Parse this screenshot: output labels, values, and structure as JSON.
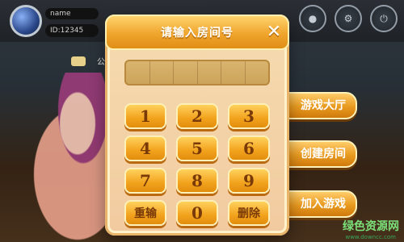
{
  "top_bar": {
    "player_name": "name",
    "player_id": "ID:12345",
    "icons": [
      {
        "name": "icon-1",
        "label": "●"
      },
      {
        "name": "settings-icon",
        "label": "设置"
      },
      {
        "name": "power-icon",
        "label": "退出"
      }
    ]
  },
  "announcement": {
    "label": "公"
  },
  "menu": {
    "game_lobby": "游戏大厅",
    "create_room": "创建房间",
    "join_game": "加入游戏"
  },
  "modal": {
    "title": "请输入房间号",
    "close_label": "✕",
    "code_cells": [
      "",
      "",
      "",
      "",
      "",
      ""
    ],
    "keys": [
      "1",
      "2",
      "3",
      "4",
      "5",
      "6",
      "7",
      "8",
      "9",
      "重输",
      "0",
      "删除"
    ]
  },
  "watermark": {
    "brand": "绿色资源网",
    "url": "www.downcc.com"
  },
  "colors": {
    "accent_orange": "#f0a52d",
    "key_text": "#7a3a07",
    "watermark_green": "#3aa85d"
  }
}
